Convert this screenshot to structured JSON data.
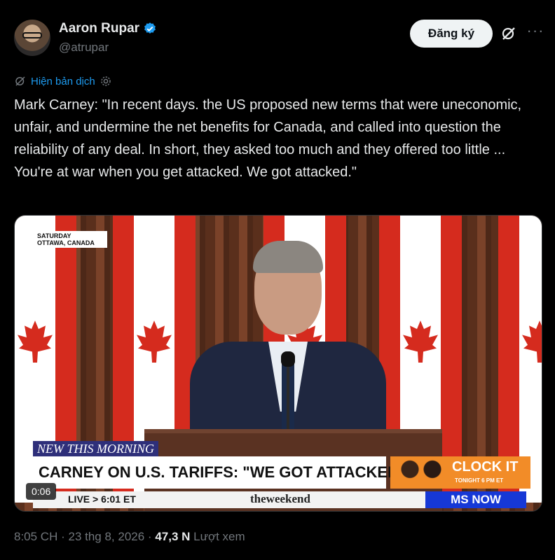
{
  "author": {
    "name": "Aaron Rupar",
    "handle": "@atrupar",
    "verified": true,
    "verified_color": "#1d9bf0"
  },
  "actions": {
    "subscribe_label": "Đăng ký",
    "grok_icon": "grok-icon",
    "more_icon": "more-icon",
    "more_label": "···"
  },
  "translate": {
    "label": "Hiện bản dịch",
    "icon": "grok-icon",
    "settings_icon": "gear-icon"
  },
  "tweet": {
    "text": "Mark Carney: \"In recent days. the US proposed new terms that were uneconomic, unfair, and undermine the net benefits for Canada, and called into question the reliability of any deal. In short, they asked too much and they offered too little ... You're at war when you get attacked. We got attacked.\""
  },
  "media": {
    "location_line1": "SATURDAY",
    "location_line2": "OTTAWA, CANADA",
    "badge": "NEW THIS MORNING",
    "headline": "CARNEY ON U.S. TARIFFS: \"WE GOT ATTACKED\"",
    "promo_title": "CLOCK IT",
    "promo_sub": "TONIGHT 6 PM ET",
    "live_text": "LIVE > 6:01 ET",
    "show_brand": "theweekend",
    "network": "MS NOW",
    "timecode": "0:06"
  },
  "meta": {
    "time": "8:05 CH",
    "separator": " · ",
    "date": "23 thg 8, 2026",
    "views": "47,3 N",
    "views_label": " Lượt xem"
  },
  "colors": {
    "background": "#000000",
    "text": "#e7e9ea",
    "muted": "#71767b",
    "link": "#1d9bf0"
  }
}
